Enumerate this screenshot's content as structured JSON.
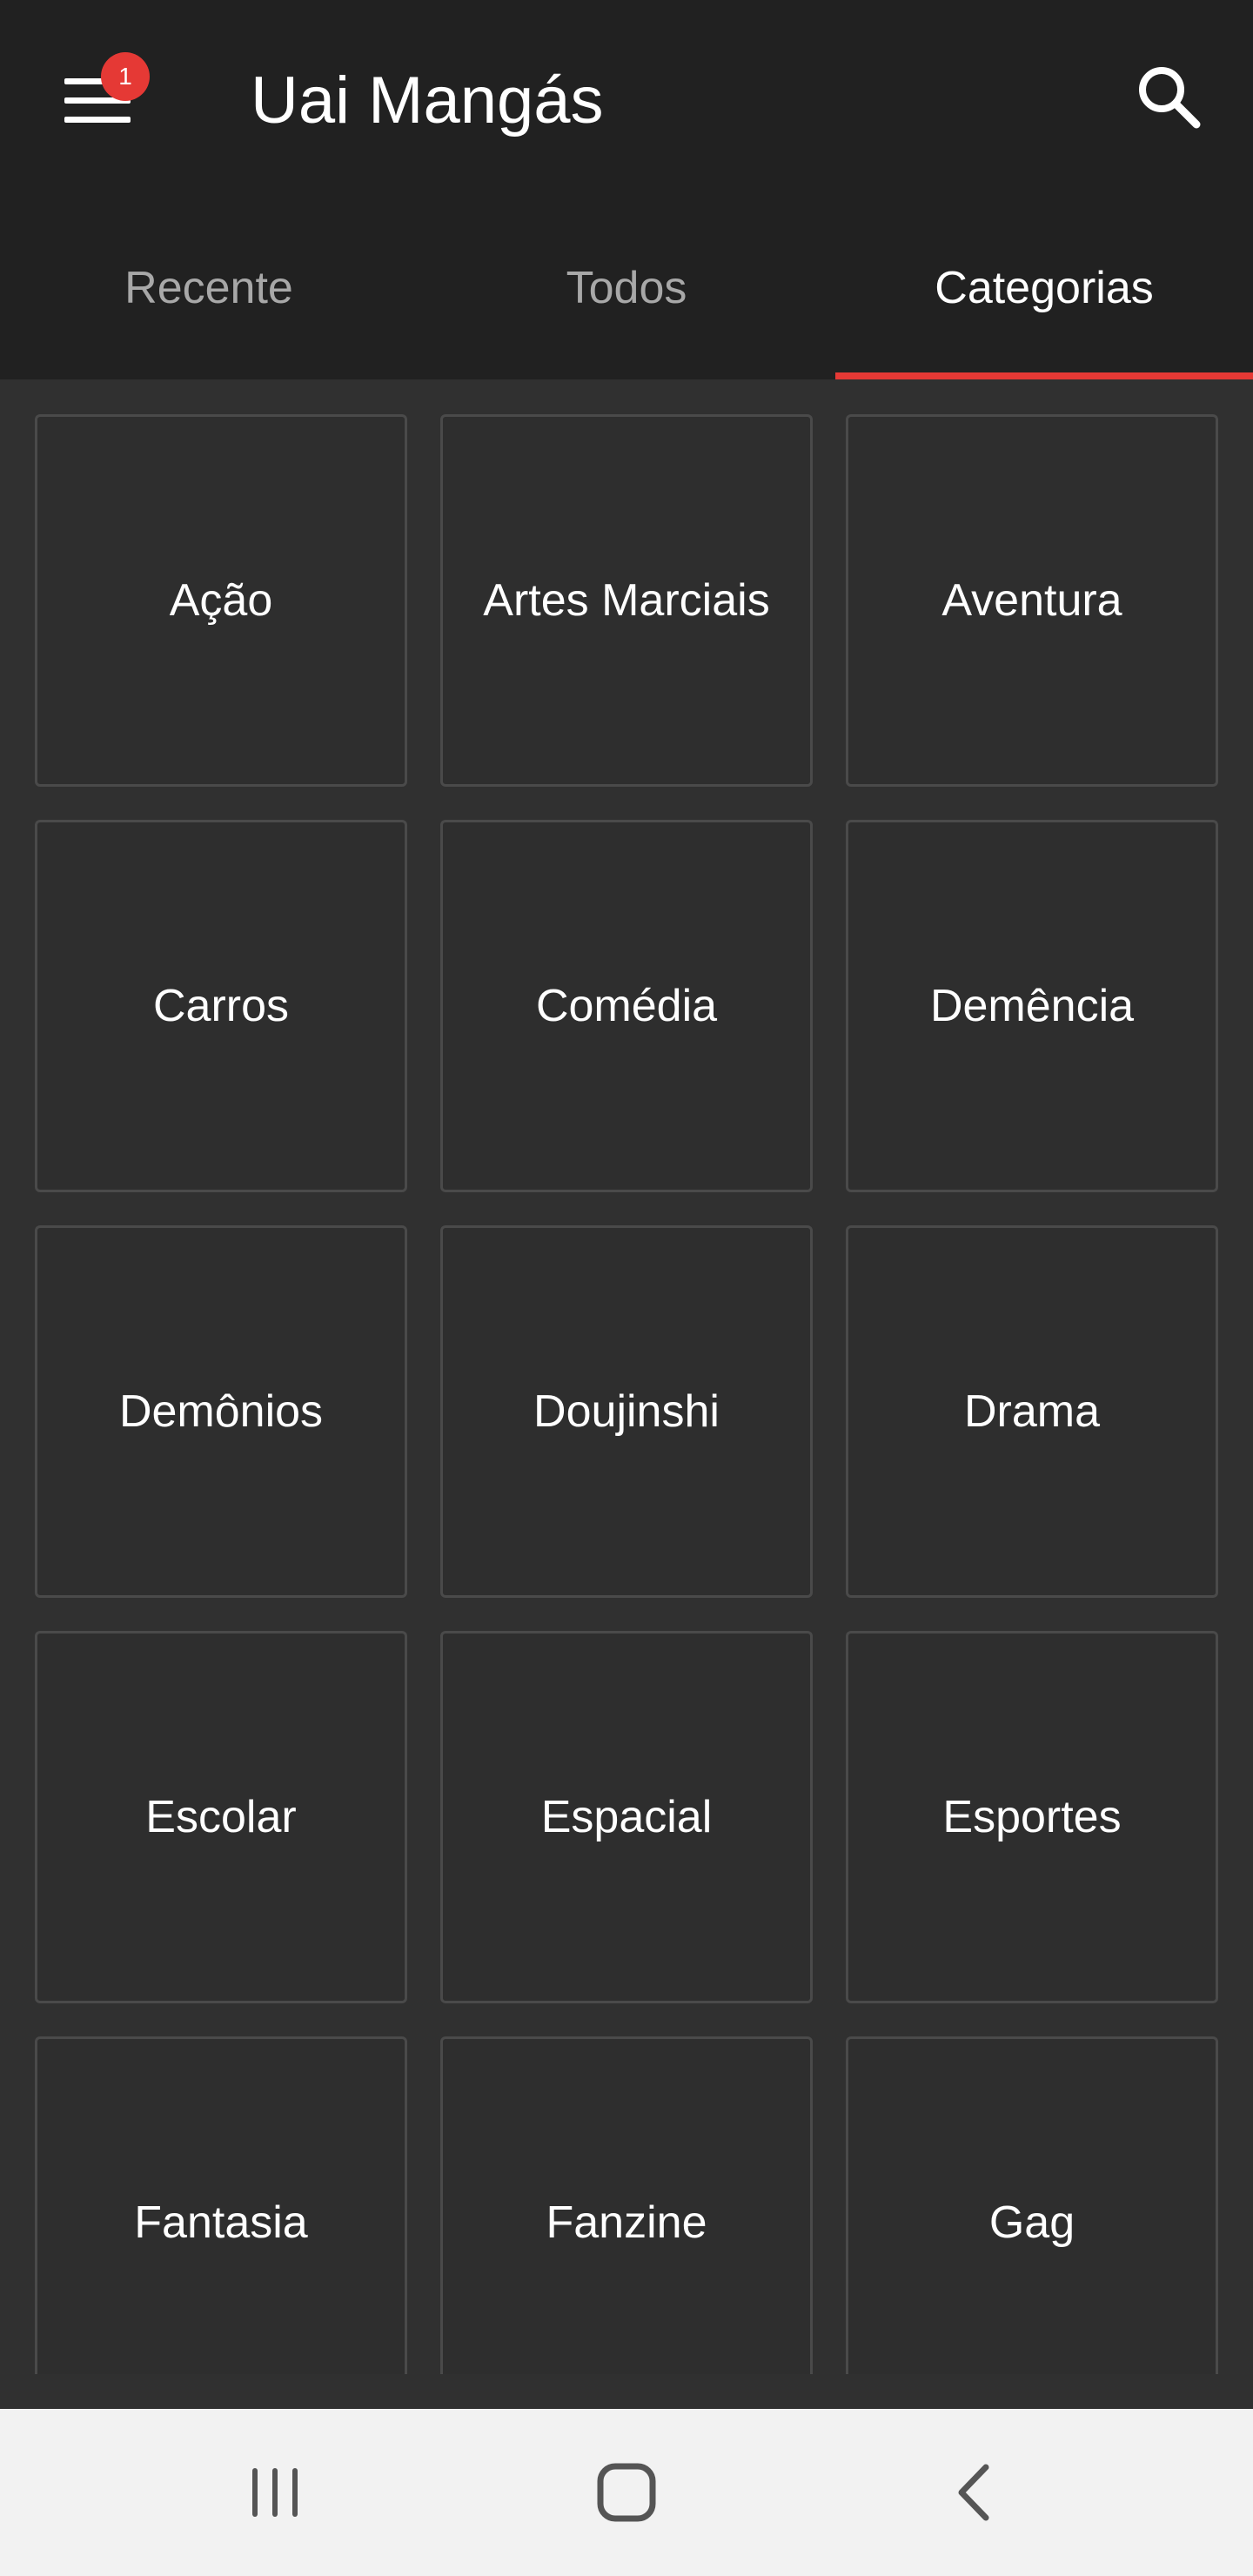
{
  "app": {
    "title": "Uai Mangás",
    "notification_count": "1",
    "accent_color": "#e53935"
  },
  "tabs": [
    {
      "label": "Recente",
      "active": false
    },
    {
      "label": "Todos",
      "active": false
    },
    {
      "label": "Categorias",
      "active": true
    }
  ],
  "categories": [
    "Ação",
    "Artes Marciais",
    "Aventura",
    "Carros",
    "Comédia",
    "Demência",
    "Demônios",
    "Doujinshi",
    "Drama",
    "Escolar",
    "Espacial",
    "Esportes",
    "Fantasia",
    "Fanzine",
    "Gag"
  ],
  "icons": {
    "menu": "menu-icon",
    "search": "search-icon",
    "recents": "recent-apps-icon",
    "home": "home-icon",
    "back": "back-icon"
  }
}
